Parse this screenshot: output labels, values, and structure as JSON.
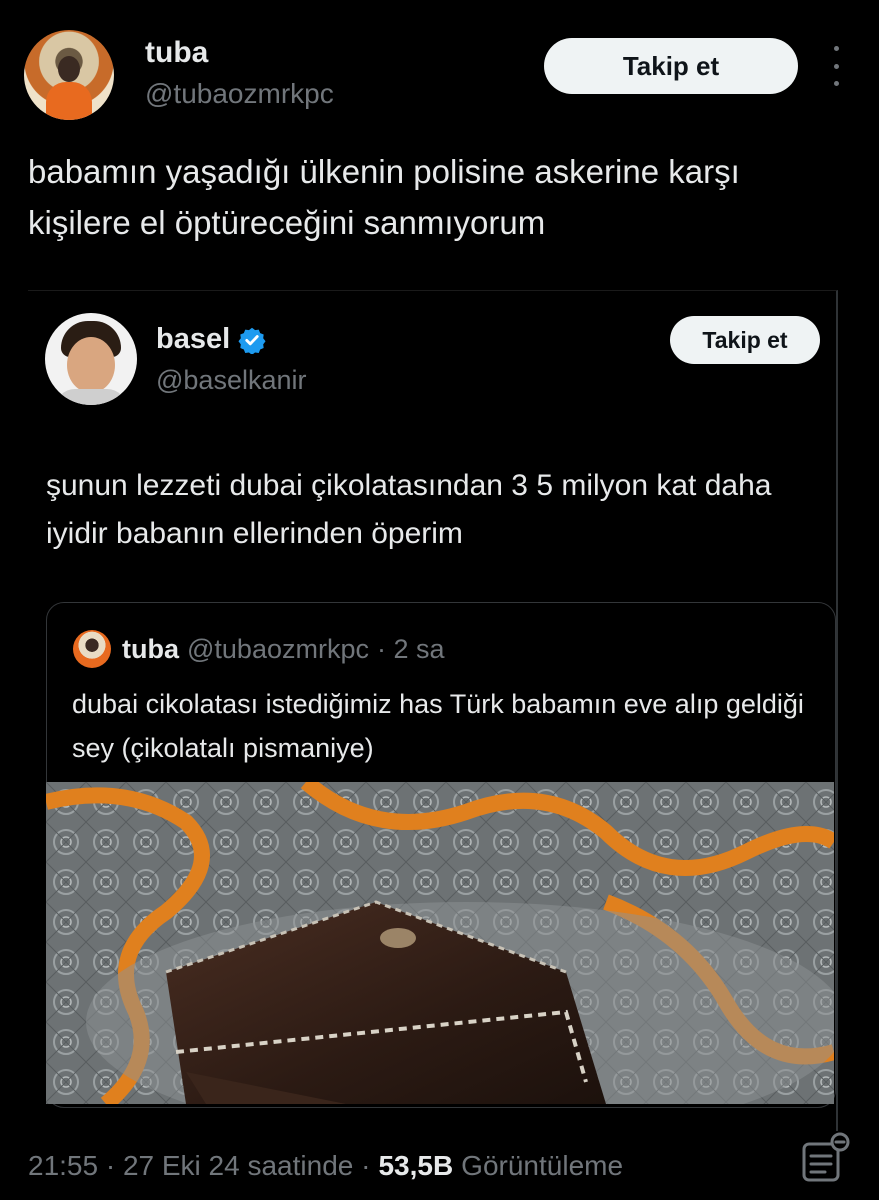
{
  "main_tweet": {
    "author_name": "tuba",
    "author_handle": "@tubaozmrkpc",
    "follow_label": "Takip et",
    "text": "babamın yaşadığı ülkenin polisine askerine karşı kişilere el öptüreceğini sanmıyorum"
  },
  "quoted_tweet": {
    "author_name": "basel",
    "author_handle": "@baselkanir",
    "verified": true,
    "follow_label": "Takip et",
    "text": "şunun lezzeti dubai çikolatasından 3 5 milyon kat daha iyidir babanın ellerinden öperim"
  },
  "inner_quote": {
    "author_name": "tuba",
    "author_handle": "@tubaozmrkpc",
    "time": "· 2 sa",
    "text": "dubai cikolatası istediğimiz has Türk babamın eve alıp geldiği sey (çikolatalı pismaniye)"
  },
  "footer": {
    "time": "21:55 · 27 Eki 24 saatinde ·",
    "views_count": "53,5B",
    "views_label": "Görüntüleme"
  },
  "colors": {
    "background": "#000000",
    "text": "#e7e9ea",
    "muted": "#71767b",
    "verified": "#1d9bf0",
    "button_bg": "#eff3f4"
  },
  "icons": {
    "more": "more-icon",
    "verified": "verified-badge-icon",
    "analytics": "analytics-icon"
  }
}
